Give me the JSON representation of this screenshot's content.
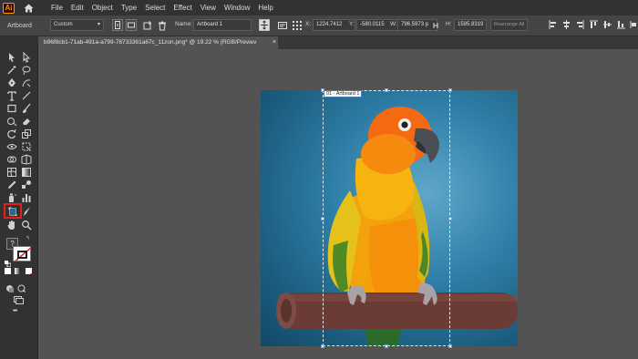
{
  "app": {
    "logo": "Ai"
  },
  "menu": {
    "items": [
      "File",
      "Edit",
      "Object",
      "Type",
      "Select",
      "Effect",
      "View",
      "Window",
      "Help"
    ]
  },
  "control_bar": {
    "mode_label": "Artboard",
    "preset_value": "Custom",
    "name_label": "Name:",
    "name_value": "Artboard 1",
    "x_label": "X:",
    "x_value": "1224.7412",
    "y_label": "Y:",
    "y_value": "-580.0115",
    "w_label": "W:",
    "w_value": "796.5973 p",
    "h_label": "H:",
    "h_value": "1595.8319",
    "arrange_label": "Rearrange All"
  },
  "document": {
    "tab_title": "b96f8cb1-71ab-491a-a799-78733361a67c_11zon.png* @ 19.22 % (RGB/Previev",
    "close_glyph": "×"
  },
  "artboard": {
    "label": "01 - Artboard 1"
  },
  "tools": {
    "selected": "artboard-tool",
    "fill_stroke_question": "?",
    "more_tools_glyph": "•••"
  },
  "colors": {
    "app_bg": "#323232",
    "canvas_bg": "#535353",
    "highlight": "#e3201b",
    "logo_accent": "#ff9a00"
  }
}
